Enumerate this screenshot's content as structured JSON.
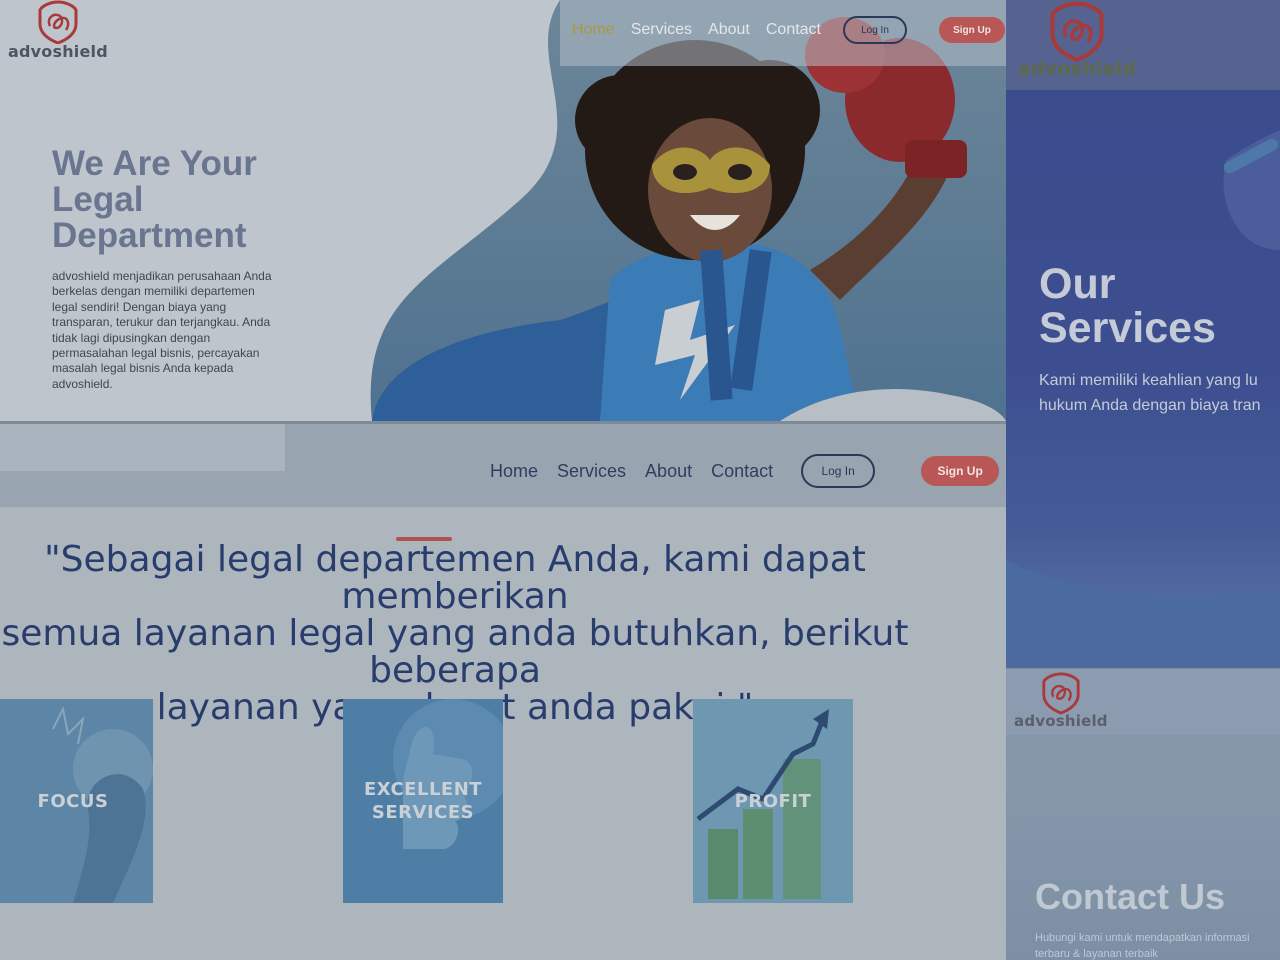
{
  "brand": {
    "name": "advoshield",
    "accent_color": "#b85755",
    "navy": "#283d6e"
  },
  "hero": {
    "nav": [
      "Home",
      "Services",
      "About",
      "Contact"
    ],
    "active_nav": "Home",
    "login_label": "Log In",
    "signup_label": "Sign Up",
    "title": "We Are Your Legal Department",
    "description": "advoshield menjadikan perusahaan Anda berkelas dengan memiliki departemen legal sendiri! Dengan biaya yang transparan, terukur dan terjangkau. Anda tidak lagi dipusingkan dengan permasalahan legal bisnis, percayakan masalah legal bisnis Anda kepada advoshield.",
    "image_icon": "superhero-kid-icon"
  },
  "services_page": {
    "nav": [
      "Home",
      "Services",
      "About",
      "Contact"
    ],
    "login_label": "Log In",
    "signup_label": "Sign Up",
    "quote_lines": [
      "\"Sebagai legal departemen Anda, kami dapat memberikan",
      "semua layanan legal yang anda butuhkan, berikut beberapa",
      "layanan yang dapat anda pakai.\""
    ],
    "cards": [
      {
        "label": "FOCUS",
        "icon": "thinking-person-icon"
      },
      {
        "label": "EXCELLENT SERVICES",
        "icon": "thumbs-up-icon"
      },
      {
        "label": "PROFIT",
        "icon": "growth-chart-icon"
      }
    ]
  },
  "our_services": {
    "title": "Our Services",
    "description_lines": [
      "Kami memiliki keahlian yang lu",
      "hukum Anda dengan biaya tran"
    ]
  },
  "contact": {
    "title": "Contact Us",
    "description": "Hubungi kami untuk mendapatkan informasi terbaru & layanan terbaik"
  }
}
